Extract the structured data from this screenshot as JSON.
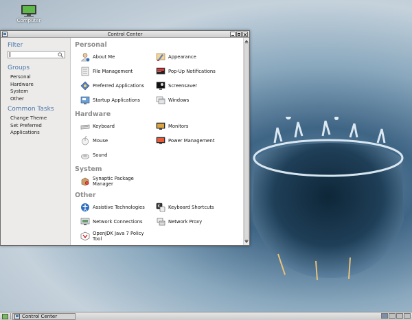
{
  "desktop": {
    "icon_label": "Computer"
  },
  "window": {
    "title": "Control Center"
  },
  "sidebar": {
    "filter_label": "Filter",
    "search_value": "",
    "groups_label": "Groups",
    "groups": [
      "Personal",
      "Hardware",
      "System",
      "Other"
    ],
    "tasks_label": "Common Tasks",
    "tasks": [
      "Change Theme",
      "Set Preferred Applications"
    ]
  },
  "sections": [
    {
      "title": "Personal",
      "items": [
        {
          "label": "About Me",
          "icon": "user-icon"
        },
        {
          "label": "Appearance",
          "icon": "appearance-icon"
        },
        {
          "label": "File Management",
          "icon": "file-management-icon"
        },
        {
          "label": "Pop-Up Notifications",
          "icon": "notification-icon"
        },
        {
          "label": "Preferred Applications",
          "icon": "preferred-apps-icon"
        },
        {
          "label": "Screensaver",
          "icon": "screensaver-icon"
        },
        {
          "label": "Startup Applications",
          "icon": "startup-icon"
        },
        {
          "label": "Windows",
          "icon": "windows-icon"
        }
      ]
    },
    {
      "title": "Hardware",
      "items": [
        {
          "label": "Keyboard",
          "icon": "keyboard-icon"
        },
        {
          "label": "Monitors",
          "icon": "monitor-icon"
        },
        {
          "label": "Mouse",
          "icon": "mouse-icon"
        },
        {
          "label": "Power Management",
          "icon": "power-icon"
        },
        {
          "label": "Sound",
          "icon": "sound-icon"
        }
      ]
    },
    {
      "title": "System",
      "items": [
        {
          "label": "Synaptic Package Manager",
          "icon": "package-icon"
        }
      ]
    },
    {
      "title": "Other",
      "items": [
        {
          "label": "Assistive Technologies",
          "icon": "accessibility-icon"
        },
        {
          "label": "Keyboard Shortcuts",
          "icon": "keyboard-shortcuts-icon"
        },
        {
          "label": "Network Connections",
          "icon": "network-icon"
        },
        {
          "label": "Network Proxy",
          "icon": "proxy-icon"
        },
        {
          "label": "OpenJDK Java 7 Policy Tool",
          "icon": "java-icon"
        }
      ]
    }
  ],
  "taskbar": {
    "task_label": "Control Center"
  }
}
